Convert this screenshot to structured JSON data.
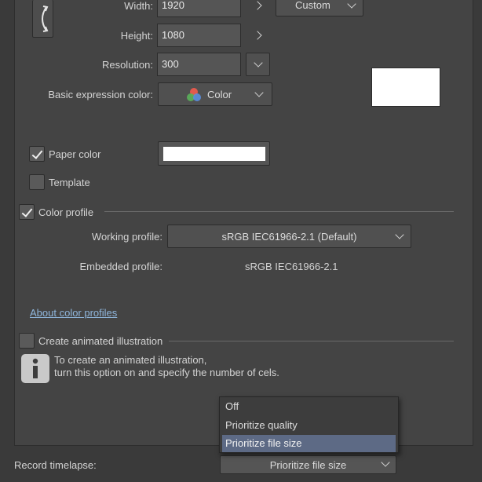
{
  "size": {
    "width_label": "Width:",
    "width_value": "1920",
    "height_label": "Height:",
    "height_value": "1080",
    "preset_value": "Custom",
    "resolution_label": "Resolution:",
    "resolution_value": "300"
  },
  "expression": {
    "label": "Basic expression color:",
    "value": "Color"
  },
  "paper": {
    "label": "Paper color",
    "checked": true,
    "swatch_color": "#ffffff"
  },
  "template": {
    "label": "Template",
    "checked": false
  },
  "color_profile": {
    "label": "Color profile",
    "checked": true,
    "working_label": "Working profile:",
    "working_value": "sRGB IEC61966-2.1 (Default)",
    "embedded_label": "Embedded profile:",
    "embedded_value": "sRGB IEC61966-2.1",
    "about_link": "About color profiles"
  },
  "animation": {
    "label": "Create animated illustration",
    "checked": false,
    "info_line1": "To create an animated illustration,",
    "info_line2": "turn this option on and specify the number of cels."
  },
  "timelapse": {
    "label": "Record timelapse:",
    "value": "Prioritize file size",
    "options": [
      "Off",
      "Prioritize quality",
      "Prioritize file size"
    ],
    "selected_index": 2
  },
  "colors": {
    "background": "#3a3a3a",
    "panel": "#444444",
    "field": "#555555",
    "link": "#8fb6dc",
    "selection": "#5d6a85"
  }
}
